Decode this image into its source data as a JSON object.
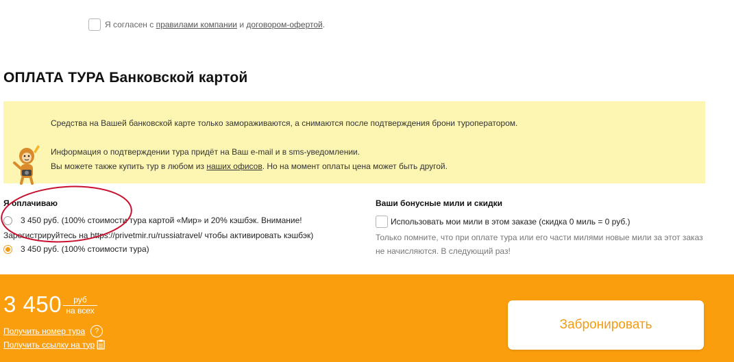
{
  "agreement": {
    "prefix": "Я согласен с",
    "rules_link": "правилами компании",
    "and": "и",
    "offer_link": "договором-офертой",
    "suffix": "."
  },
  "section_title": "ОПЛАТА ТУРА Банковской картой",
  "notice": {
    "line1": "Средства на Вашей банковской карте только замораживаются, а снимаются после подтверждения брони туроператором.",
    "line2": "Информация о подтверждении тура придёт на Ваш e-mail и в sms-уведомлении.",
    "line3_prefix": "Вы можете также купить тур в любом из",
    "line3_link": "наших офисов",
    "line3_suffix": ". Но на момент оплаты цена может быть другой."
  },
  "payment": {
    "heading": "Я оплачиваю",
    "option1_line1": "3 450 руб. (100% стоимости тура картой «Мир» и 20% кэшбэк. Внимание!",
    "option1_line2": "Зарегистрируйтесь на https://privetmir.ru/russiatravel/ чтобы активировать кэшбэк)",
    "option1_selected": false,
    "option2": "3 450 руб. (100% стоимости тура)",
    "option2_selected": true
  },
  "miles": {
    "heading": "Ваши бонусные мили и скидки",
    "checkbox_label": "Использовать мои мили в этом заказе (скидка 0 миль = 0 руб.)",
    "checked": false,
    "note": "Только помните, что при оплате тура или его части милями новые мили за этот заказ не начисляются. В следующий раз!"
  },
  "footer": {
    "price": "3 450",
    "unit_top": "руб",
    "unit_bottom": "на всех",
    "get_number_link": "Получить номер тура",
    "help_icon": "?",
    "get_link": "Получить ссылку на тур",
    "book_button": "Забронировать"
  },
  "colors": {
    "accent": "#fa9e0d",
    "notice_bg": "#fdf6b3",
    "annotation": "#c8102e"
  },
  "icons": [
    "checkbox-icon",
    "mascot-icon",
    "question-icon",
    "clipboard-icon"
  ]
}
